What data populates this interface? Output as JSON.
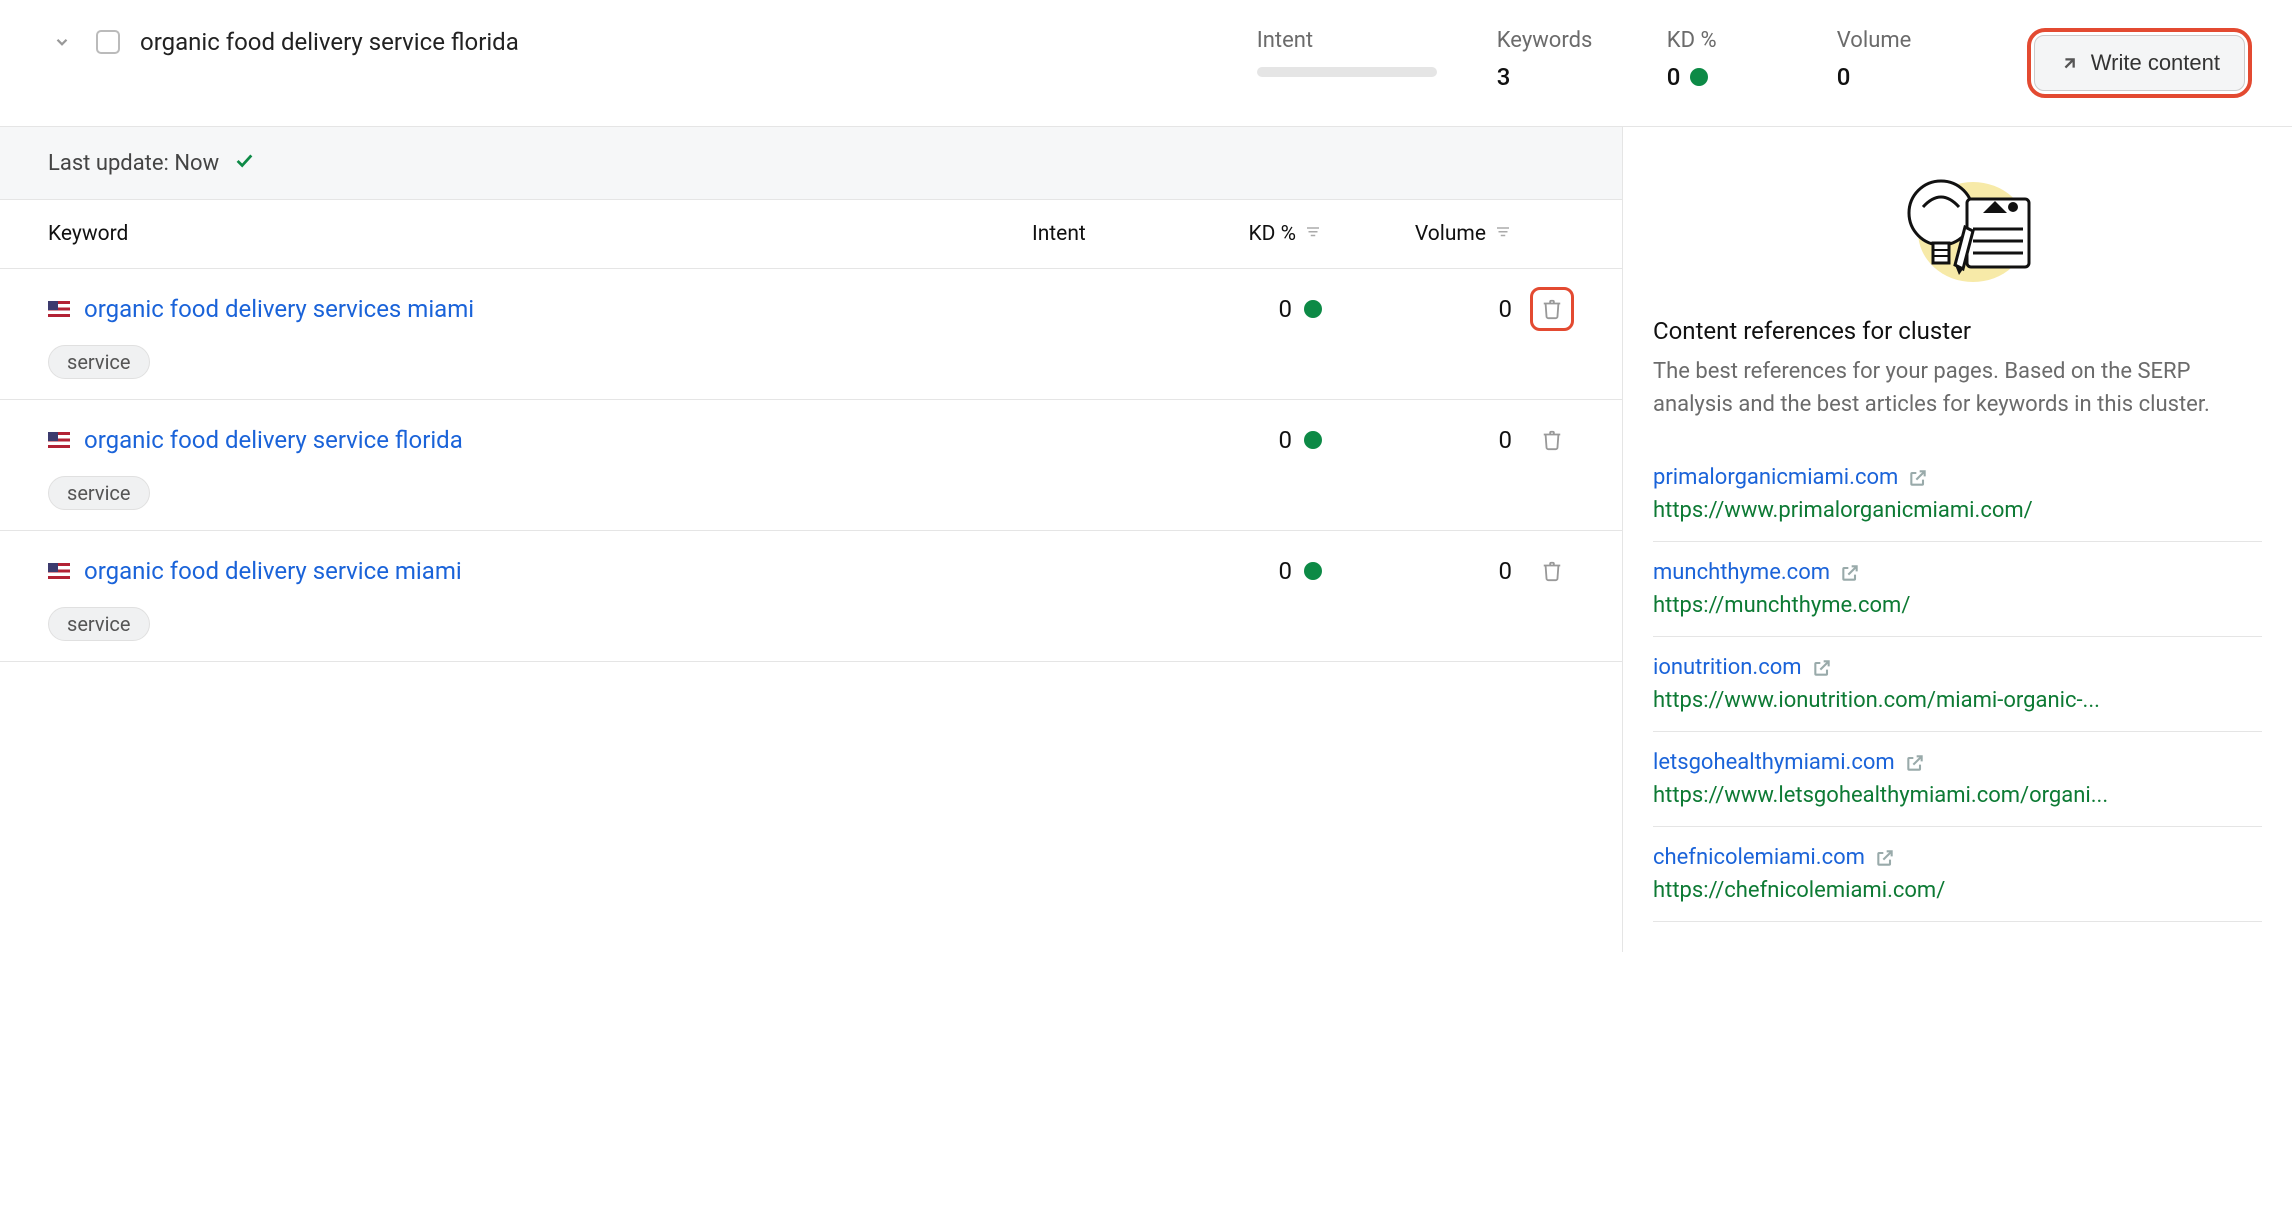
{
  "header": {
    "cluster_title": "organic food delivery service florida",
    "metrics": {
      "intent_label": "Intent",
      "keywords_label": "Keywords",
      "keywords_value": "3",
      "kd_label": "KD %",
      "kd_value": "0",
      "volume_label": "Volume",
      "volume_value": "0"
    },
    "write_button": "Write content"
  },
  "update_bar": {
    "label": "Last update: Now"
  },
  "table": {
    "headers": {
      "keyword": "Keyword",
      "intent": "Intent",
      "kd": "KD %",
      "volume": "Volume"
    },
    "rows": [
      {
        "keyword": "organic food delivery services miami",
        "kd": "0",
        "volume": "0",
        "tag": "service",
        "flag": "us",
        "trash_highlight": true
      },
      {
        "keyword": "organic food delivery service florida",
        "kd": "0",
        "volume": "0",
        "tag": "service",
        "flag": "us",
        "trash_highlight": false
      },
      {
        "keyword": "organic food delivery service miami",
        "kd": "0",
        "volume": "0",
        "tag": "service",
        "flag": "us",
        "trash_highlight": false
      }
    ]
  },
  "references": {
    "title": "Content references for cluster",
    "desc": "The best references for your pages. Based on the SERP analysis and the best articles for keywords in this cluster.",
    "items": [
      {
        "domain": "primalorganicmiami.com",
        "url": "https://www.primalorganicmiami.com/"
      },
      {
        "domain": "munchthyme.com",
        "url": "https://munchthyme.com/"
      },
      {
        "domain": "ionutrition.com",
        "url": "https://www.ionutrition.com/miami-organic-..."
      },
      {
        "domain": "letsgohealthymiami.com",
        "url": "https://www.letsgohealthymiami.com/organi..."
      },
      {
        "domain": "chefnicolemiami.com",
        "url": "https://chefnicolemiami.com/"
      }
    ]
  }
}
